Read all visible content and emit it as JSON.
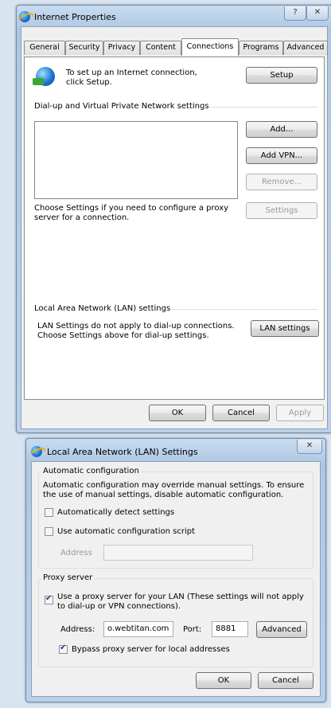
{
  "internet_properties": {
    "title": "Internet Properties",
    "help_button": "?",
    "close_button": "✕",
    "tabs": [
      "General",
      "Security",
      "Privacy",
      "Content",
      "Connections",
      "Programs",
      "Advanced"
    ],
    "active_tab": "Connections",
    "setup_text": "To set up an Internet connection, click Setup.",
    "setup_button": "Setup",
    "dialup_group_label": "Dial-up and Virtual Private Network settings",
    "add_button": "Add...",
    "add_vpn_button": "Add VPN...",
    "remove_button": "Remove...",
    "settings_text": "Choose Settings if you need to configure a proxy server for a connection.",
    "settings_button": "Settings",
    "lan_group_label": "Local Area Network (LAN) settings",
    "lan_text": "LAN Settings do not apply to dial-up connections. Choose Settings above for dial-up settings.",
    "lan_settings_button": "LAN settings",
    "ok_button": "OK",
    "cancel_button": "Cancel",
    "apply_button": "Apply"
  },
  "lan_dialog": {
    "title": "Local Area Network (LAN) Settings",
    "close_button": "✕",
    "auto_config_legend": "Automatic configuration",
    "auto_config_text": "Automatic configuration may override manual settings.  To ensure the use of manual settings, disable automatic configuration.",
    "auto_detect_label": "Automatically detect settings",
    "auto_detect_checked": false,
    "auto_script_label": "Use automatic configuration script",
    "auto_script_checked": false,
    "script_address_label": "Address",
    "script_address_value": "",
    "proxy_legend": "Proxy server",
    "use_proxy_label": "Use a proxy server for your LAN (These settings will not apply to dial-up or VPN connections).",
    "use_proxy_checked": true,
    "proxy_address_label": "Address:",
    "proxy_address_value": "o.webtitan.com",
    "port_label": "Port:",
    "port_value": "8881",
    "advanced_button": "Advanced",
    "bypass_label": "Bypass proxy server for local addresses",
    "bypass_checked": true,
    "ok_button": "OK",
    "cancel_button": "Cancel"
  }
}
